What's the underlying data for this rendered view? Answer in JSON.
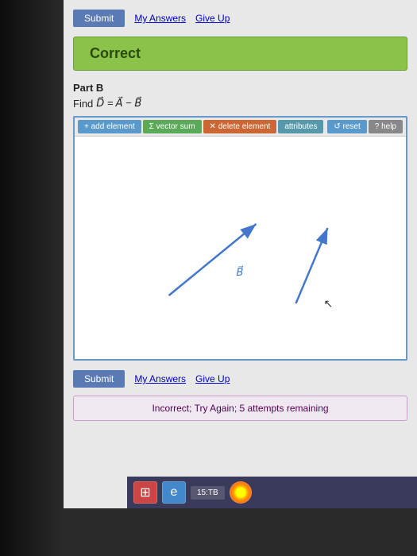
{
  "top": {
    "submit_label": "Submit",
    "my_answers_label": "My Answers",
    "give_up_label": "Give Up",
    "correct_text": "Correct"
  },
  "part_b": {
    "label": "Part B",
    "find_prefix": "Find ",
    "equation": "D⃗ = A⃗ − B⃗"
  },
  "toolbar": {
    "add_element": "+ add element",
    "vector_sum": "Σ vector sum",
    "delete_element": "✕ delete element",
    "attributes": "attributes",
    "reset": "↺ reset",
    "help": "? help"
  },
  "bottom": {
    "submit_label": "Submit",
    "my_answers_label": "My Answers",
    "give_up_label": "Give Up",
    "incorrect_text": "Incorrect; Try Again; 5 attempts remaining"
  },
  "taskbar": {
    "windows_icon": "⊞",
    "ie_icon": "e",
    "item_label": "15:TB",
    "chrome_label": ""
  }
}
